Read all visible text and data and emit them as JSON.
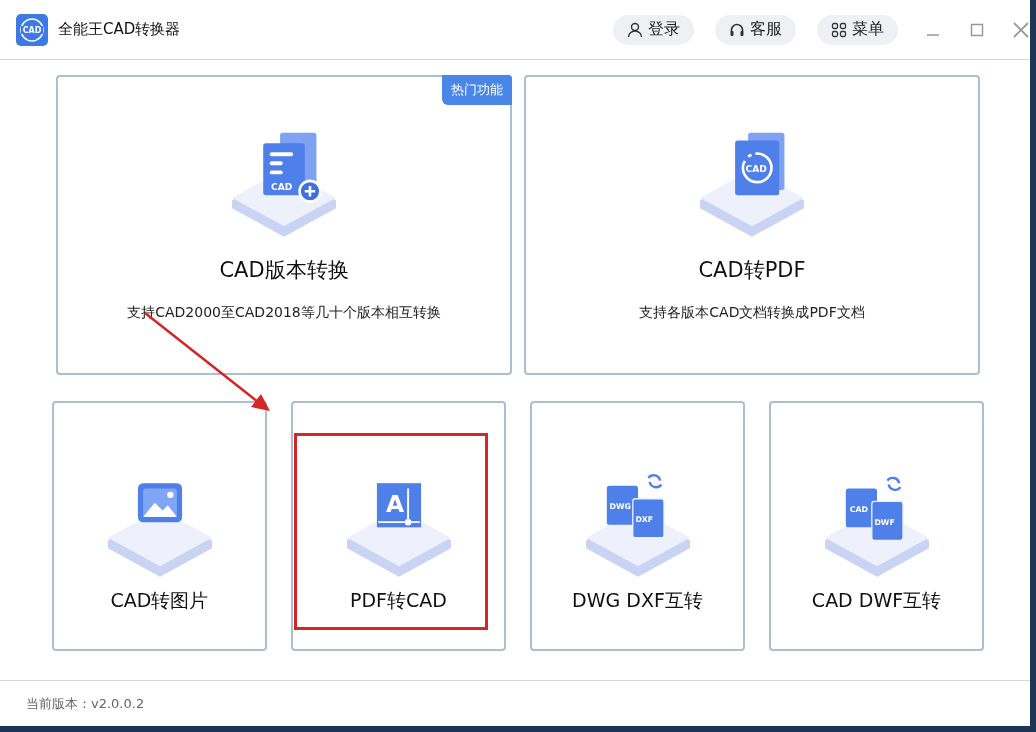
{
  "window": {
    "title": "全能王CAD转换器",
    "logo_text": "CAD"
  },
  "header_buttons": [
    {
      "kind": "user",
      "label": "登录"
    },
    {
      "kind": "headset",
      "label": "客服"
    },
    {
      "kind": "grid",
      "label": "菜单"
    }
  ],
  "top_features": [
    {
      "title": "CAD版本转换",
      "description": "支持CAD2000至CAD2018等几十个版本相互转换",
      "badge": "热门功能",
      "icon_text": [
        "CAD"
      ]
    },
    {
      "title": "CAD转PDF",
      "description": "支持各版本CAD文档转换成PDF文档",
      "icon_text": [
        "CAD"
      ]
    }
  ],
  "bottom_features": [
    {
      "title": "CAD转图片",
      "highlighted": false
    },
    {
      "title": "PDF转CAD",
      "highlighted": true,
      "icon_text": [
        "A"
      ]
    },
    {
      "title": "DWG DXF互转",
      "highlighted": false,
      "icon_text": [
        "DWG",
        "DXF"
      ]
    },
    {
      "title": "CAD DWF互转",
      "highlighted": false,
      "icon_text": [
        "CAD",
        "DWF"
      ]
    }
  ],
  "status_bar": {
    "version": "当前版本：v2.0.0.2"
  }
}
